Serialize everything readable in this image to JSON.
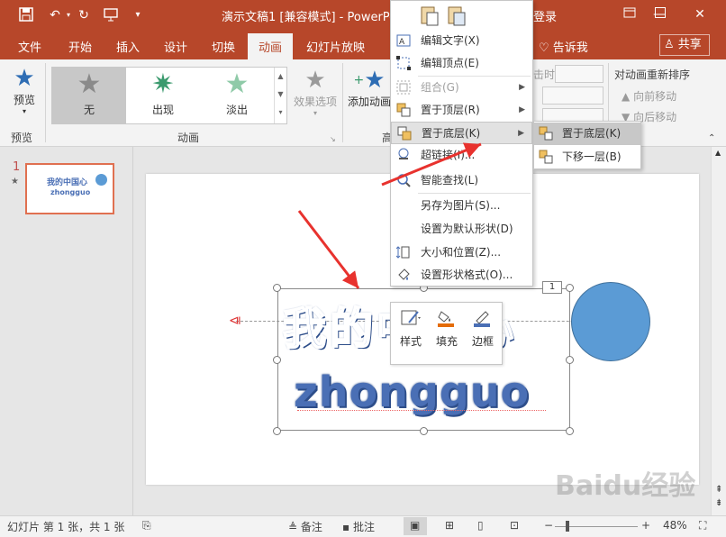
{
  "titlebar": {
    "title": "演示文稿1 [兼容模式] - PowerPoint",
    "login": "登录",
    "qat_icons": [
      "save-icon",
      "undo-icon",
      "redo-icon",
      "presentation-icon",
      "customize-icon"
    ],
    "window_controls": [
      "ribbon-options-icon",
      "minimize-icon",
      "maximize-icon",
      "close-icon"
    ]
  },
  "tabs": [
    "文件",
    "开始",
    "插入",
    "设计",
    "切换",
    "动画",
    "幻灯片放映"
  ],
  "active_tab": "动画",
  "tellme": "告诉我",
  "share": "共享",
  "ribbon": {
    "preview_label": "预览",
    "preview_group": "预览",
    "animation_group": "动画",
    "gallery": [
      "无",
      "出现",
      "淡出"
    ],
    "effect_options": "效果选项",
    "add_animation": "添加动画",
    "advanced_partial": "高",
    "start_label": "击时",
    "reorder_title": "对动画重新排序",
    "move_earlier": "向前移动",
    "move_later": "向后移动"
  },
  "thumbnail": {
    "number": "1",
    "star": "★",
    "line1": "我的中国心",
    "line2": "zhongguo"
  },
  "slide": {
    "text1": "我的中国心",
    "text2": "zhongguo",
    "anim_tag": "1"
  },
  "minitoolbar": {
    "style": "样式",
    "fill": "填充",
    "border": "边框"
  },
  "context_menu": {
    "edit_text": "编辑文字(X)",
    "edit_points": "编辑顶点(E)",
    "group": "组合(G)",
    "bring_front": "置于顶层(R)",
    "send_back": "置于底层(K)",
    "hyperlink": "超链接(I)...",
    "smart_lookup": "智能查找(L)",
    "save_as_picture": "另存为图片(S)...",
    "set_default": "设置为默认形状(D)",
    "size_position": "大小和位置(Z)...",
    "format_shape": "设置形状格式(O)..."
  },
  "submenu": {
    "send_to_back": "置于底层(K)",
    "send_backward": "下移一层(B)"
  },
  "statusbar": {
    "slide_info": "幻灯片 第 1 张，共 1 张",
    "notes": "备注",
    "comments": "批注",
    "zoom": "48%"
  },
  "watermark": "Baidu经验",
  "colors": {
    "accent": "#b7472a",
    "arrow": "#e8322e",
    "circle": "#5b9bd5",
    "text_blue": "#4a6fb5"
  }
}
